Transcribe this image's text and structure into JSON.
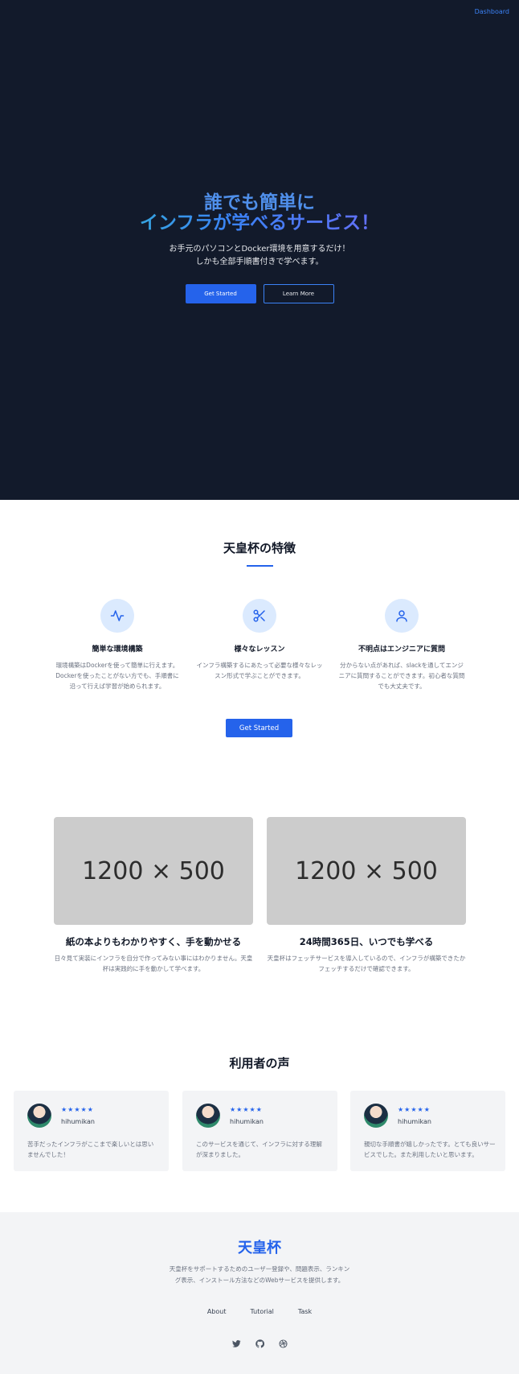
{
  "header": {
    "dashboard_link": "Dashboard"
  },
  "hero": {
    "title_line1": "誰でも簡単に",
    "title_line2": "インフラが学べるサービス！",
    "subtitle_line1": "お手元のパソコンとDocker環境を用意するだけ！",
    "subtitle_line2": "しかも全部手順書付きで学べます。",
    "primary_button": "Get Started",
    "secondary_button": "Learn More"
  },
  "features": {
    "title": "天皇杯の特徴",
    "items": [
      {
        "icon": "activity-icon",
        "title": "簡単な環境構築",
        "desc": "環境構築はDockerを使って簡単に行えます。Dockerを使ったことがない方でも、手順書に沿って行えば学習が始められます。"
      },
      {
        "icon": "scissors-icon",
        "title": "様々なレッスン",
        "desc": "インフラ構築するにあたって必要な様々なレッスン形式で学ぶことができます。"
      },
      {
        "icon": "user-icon",
        "title": "不明点はエンジニアに質問",
        "desc": "分からない点があれば、slackを通してエンジニアに質問することができます。初心者な質問でも大丈夫です。"
      }
    ],
    "button": "Get Started"
  },
  "showcase": {
    "cards": [
      {
        "placeholder": "1200 × 500",
        "title": "紙の本よりもわかりやすく、手を動かせる",
        "desc": "日々見て実装にインフラを自分で作ってみない事にはわかりません。天皇杯は実践的に手を動かして学べます。"
      },
      {
        "placeholder": "1200 × 500",
        "title": "24時間365日、いつでも学べる",
        "desc": "天皇杯はフェッチサービスを導入しているので、インフラが構築できたかフェッチするだけで確認できます。"
      }
    ]
  },
  "voices": {
    "title": "利用者の声",
    "items": [
      {
        "stars": "★★★★★",
        "name": "hihumikan",
        "text": "苦手だったインフラがここまで楽しいとは思いませんでした！"
      },
      {
        "stars": "★★★★★",
        "name": "hihumikan",
        "text": "このサービスを通じて、インフラに対する理解が深まりました。"
      },
      {
        "stars": "★★★★★",
        "name": "hihumikan",
        "text": "親切な手順書が嬉しかったです。とても良いサービスでした。また利用したいと思います。"
      }
    ]
  },
  "footer": {
    "brand": "天皇杯",
    "desc": "天皇杯をサポートするためのユーザー登録や、問題表示、ランキング表示、インストール方法などのWebサービスを提供します。",
    "links": [
      "About",
      "Tutorial",
      "Task"
    ],
    "social": [
      "twitter-icon",
      "github-icon",
      "dribbble-icon"
    ],
    "accent": "#2563eb"
  }
}
